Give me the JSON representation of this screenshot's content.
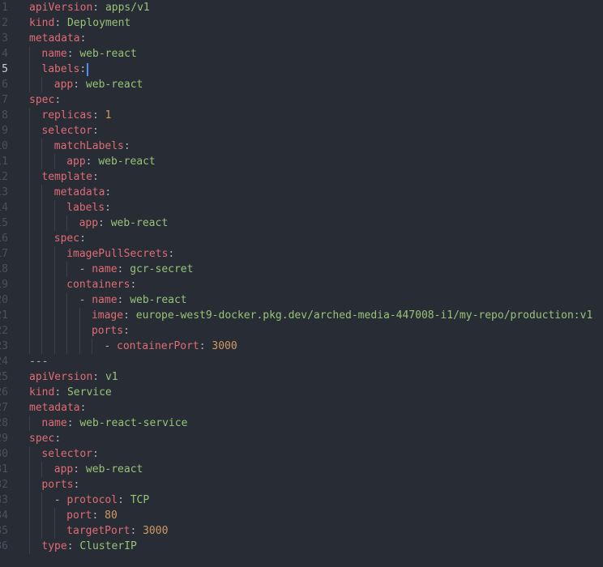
{
  "editor": {
    "active_line": 5,
    "lines": [
      {
        "num": "1",
        "indent": 0,
        "dash": false,
        "key": "apiVersion",
        "value": "apps/v1",
        "type": "s"
      },
      {
        "num": "2",
        "indent": 0,
        "dash": false,
        "key": "kind",
        "value": "Deployment",
        "type": "s"
      },
      {
        "num": "3",
        "indent": 0,
        "dash": false,
        "key": "metadata",
        "value": "",
        "type": ""
      },
      {
        "num": "4",
        "indent": 1,
        "dash": false,
        "key": "name",
        "value": "web-react",
        "type": "s"
      },
      {
        "num": "5",
        "indent": 1,
        "dash": false,
        "key": "labels",
        "value": "",
        "type": "",
        "caret": true
      },
      {
        "num": "6",
        "indent": 2,
        "dash": false,
        "key": "app",
        "value": "web-react",
        "type": "s"
      },
      {
        "num": "7",
        "indent": 0,
        "dash": false,
        "key": "spec",
        "value": "",
        "type": ""
      },
      {
        "num": "8",
        "indent": 1,
        "dash": false,
        "key": "replicas",
        "value": "1",
        "type": "n"
      },
      {
        "num": "9",
        "indent": 1,
        "dash": false,
        "key": "selector",
        "value": "",
        "type": ""
      },
      {
        "num": "10",
        "indent": 2,
        "dash": false,
        "key": "matchLabels",
        "value": "",
        "type": ""
      },
      {
        "num": "11",
        "indent": 3,
        "dash": false,
        "key": "app",
        "value": "web-react",
        "type": "s"
      },
      {
        "num": "12",
        "indent": 1,
        "dash": false,
        "key": "template",
        "value": "",
        "type": ""
      },
      {
        "num": "13",
        "indent": 2,
        "dash": false,
        "key": "metadata",
        "value": "",
        "type": ""
      },
      {
        "num": "14",
        "indent": 3,
        "dash": false,
        "key": "labels",
        "value": "",
        "type": ""
      },
      {
        "num": "15",
        "indent": 4,
        "dash": false,
        "key": "app",
        "value": "web-react",
        "type": "s"
      },
      {
        "num": "16",
        "indent": 2,
        "dash": false,
        "key": "spec",
        "value": "",
        "type": ""
      },
      {
        "num": "17",
        "indent": 3,
        "dash": false,
        "key": "imagePullSecrets",
        "value": "",
        "type": ""
      },
      {
        "num": "18",
        "indent": 4,
        "dash": true,
        "key": "name",
        "value": "gcr-secret",
        "type": "s"
      },
      {
        "num": "19",
        "indent": 3,
        "dash": false,
        "key": "containers",
        "value": "",
        "type": ""
      },
      {
        "num": "20",
        "indent": 4,
        "dash": true,
        "key": "name",
        "value": "web-react",
        "type": "s"
      },
      {
        "num": "21",
        "indent": 5,
        "dash": false,
        "key": "image",
        "value": "europe-west9-docker.pkg.dev/arched-media-447008-i1/my-repo/production:v1",
        "type": "s"
      },
      {
        "num": "22",
        "indent": 5,
        "dash": false,
        "key": "ports",
        "value": "",
        "type": ""
      },
      {
        "num": "23",
        "indent": 6,
        "dash": true,
        "key": "containerPort",
        "value": "3000",
        "type": "n"
      },
      {
        "num": "24",
        "indent": 0,
        "dash": false,
        "key": "",
        "value": "---",
        "type": "d"
      },
      {
        "num": "25",
        "indent": 0,
        "dash": false,
        "key": "apiVersion",
        "value": "v1",
        "type": "s"
      },
      {
        "num": "26",
        "indent": 0,
        "dash": false,
        "key": "kind",
        "value": "Service",
        "type": "s"
      },
      {
        "num": "27",
        "indent": 0,
        "dash": false,
        "key": "metadata",
        "value": "",
        "type": ""
      },
      {
        "num": "28",
        "indent": 1,
        "dash": false,
        "key": "name",
        "value": "web-react-service",
        "type": "s"
      },
      {
        "num": "29",
        "indent": 0,
        "dash": false,
        "key": "spec",
        "value": "",
        "type": ""
      },
      {
        "num": "30",
        "indent": 1,
        "dash": false,
        "key": "selector",
        "value": "",
        "type": ""
      },
      {
        "num": "31",
        "indent": 2,
        "dash": false,
        "key": "app",
        "value": "web-react",
        "type": "s"
      },
      {
        "num": "32",
        "indent": 1,
        "dash": false,
        "key": "ports",
        "value": "",
        "type": ""
      },
      {
        "num": "33",
        "indent": 2,
        "dash": true,
        "key": "protocol",
        "value": "TCP",
        "type": "s"
      },
      {
        "num": "34",
        "indent": 3,
        "dash": false,
        "key": "port",
        "value": "80",
        "type": "n"
      },
      {
        "num": "35",
        "indent": 3,
        "dash": false,
        "key": "targetPort",
        "value": "3000",
        "type": "n"
      },
      {
        "num": "36",
        "indent": 1,
        "dash": false,
        "key": "type",
        "value": "ClusterIP",
        "type": "s"
      }
    ]
  }
}
